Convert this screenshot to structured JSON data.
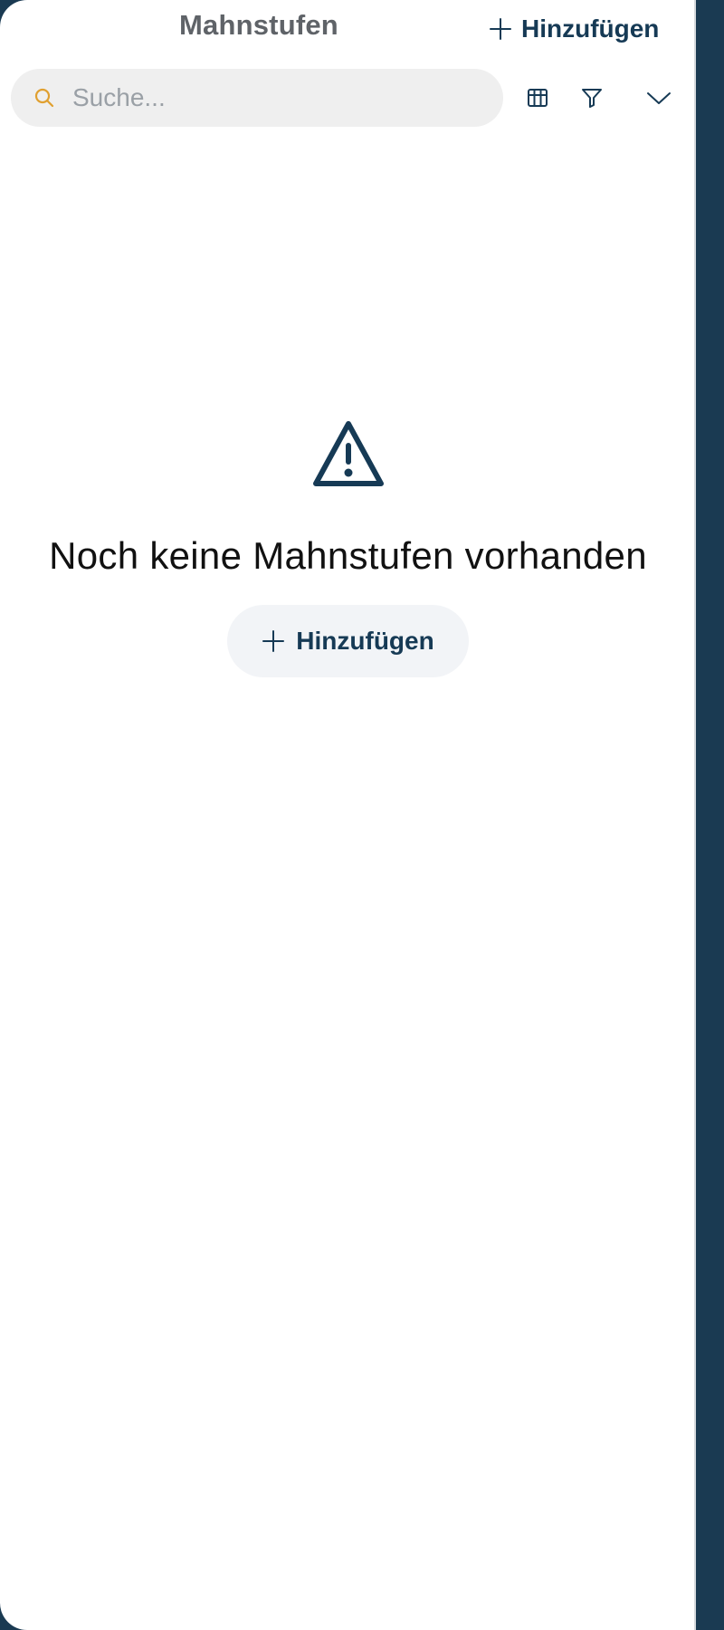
{
  "header": {
    "title": "Mahnstufen",
    "add_label": "Hinzufügen"
  },
  "search": {
    "placeholder": "Suche...",
    "value": ""
  },
  "toolbar": {
    "icons": [
      "table-icon",
      "filter-icon",
      "chevron-down-icon"
    ]
  },
  "empty_state": {
    "icon": "warning-icon",
    "message": "Noch keine Mahnstufen vorhanden",
    "add_label": "Hinzufügen"
  },
  "colors": {
    "accent": "#163a55",
    "search_icon": "#e0a030",
    "outer_background": "#1a3a52"
  }
}
